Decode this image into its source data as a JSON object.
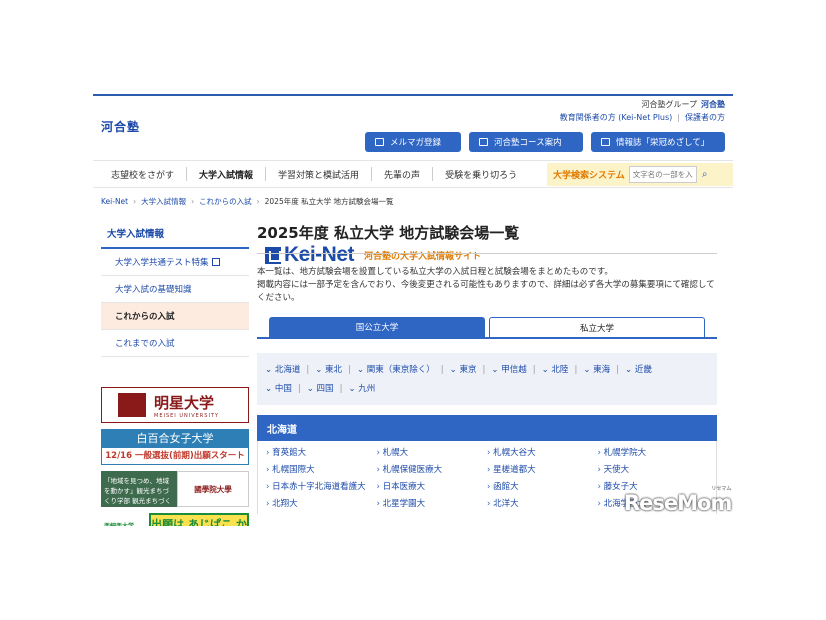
{
  "topline": {
    "group_label": "河合塾グループ",
    "brand": "河合塾"
  },
  "logo": {
    "jp": "河合塾",
    "word": "Kei-Net",
    "tagline": "河合塾の大学入試情報サイト"
  },
  "header_links": {
    "teachers": "教育関係者の方 (Kei-Net Plus)",
    "parents": "保護者の方"
  },
  "header_buttons": {
    "mail": "メルマガ登録",
    "courses": "河合塾コース案内",
    "magazine": "情報誌「栄冠めざして」"
  },
  "nav": {
    "items": [
      "志望校をさがす",
      "大学入試情報",
      "学習対策と模試活用",
      "先輩の声",
      "受験を乗り切ろう"
    ],
    "search_label": "大学検索システム",
    "search_placeholder": "文字名の一部を入力"
  },
  "breadcrumb": {
    "c1": "Kei-Net",
    "c2": "大学入試情報",
    "c3": "これからの入試",
    "c4": "2025年度 私立大学 地方試験会場一覧"
  },
  "sidebar": {
    "heading": "大学入試情報",
    "items": [
      "大学入学共通テスト特集",
      "大学入試の基礎知識",
      "これからの入試",
      "これまでの入試"
    ]
  },
  "banners": {
    "b1_title": "明星大学",
    "b1_sub": "MEISEI UNIVERSITY",
    "b2_title": "白百合女子大学",
    "b2_sub": "12/16 一般選抜(前期)出願スタート",
    "b3_left": "「地域を見つめ、地域を動かす」観光まちづくり学部 観光まちづくり学科",
    "b3_right": "國學院大學",
    "b4_left": "亜細亜大学 ASIA UNIVERSITY",
    "b4_right": "出願は あじぱこ から!!"
  },
  "main": {
    "title": "2025年度 私立大学 地方試験会場一覧",
    "desc1": "本一覧は、地方試験会場を設置している私立大学の入試日程と試験会場をまとめたものです。",
    "desc2": "掲載内容には一部予定を含んでおり、今後変更される可能性もありますので、詳細は必ず各大学の募集要項にて確認してください。",
    "tab_public": "国公立大学",
    "tab_private": "私立大学",
    "regions": [
      "北海道",
      "東北",
      "関東（東京除く）",
      "東京",
      "甲信越",
      "北陸",
      "東海",
      "近畿",
      "中国",
      "四国",
      "九州"
    ],
    "section_title": "北海道",
    "universities": [
      "育英館大",
      "札幌大",
      "札幌大谷大",
      "札幌学院大",
      "札幌国際大",
      "札幌保健医療大",
      "星槎道都大",
      "天使大",
      "日本赤十字北海道看護大",
      "日本医療大",
      "函館大",
      "藤女子大",
      "北翔大",
      "北星学園大",
      "北洋大",
      "北海学園大"
    ]
  },
  "watermark": {
    "text": "ReseMom",
    "small": "リセマム"
  }
}
